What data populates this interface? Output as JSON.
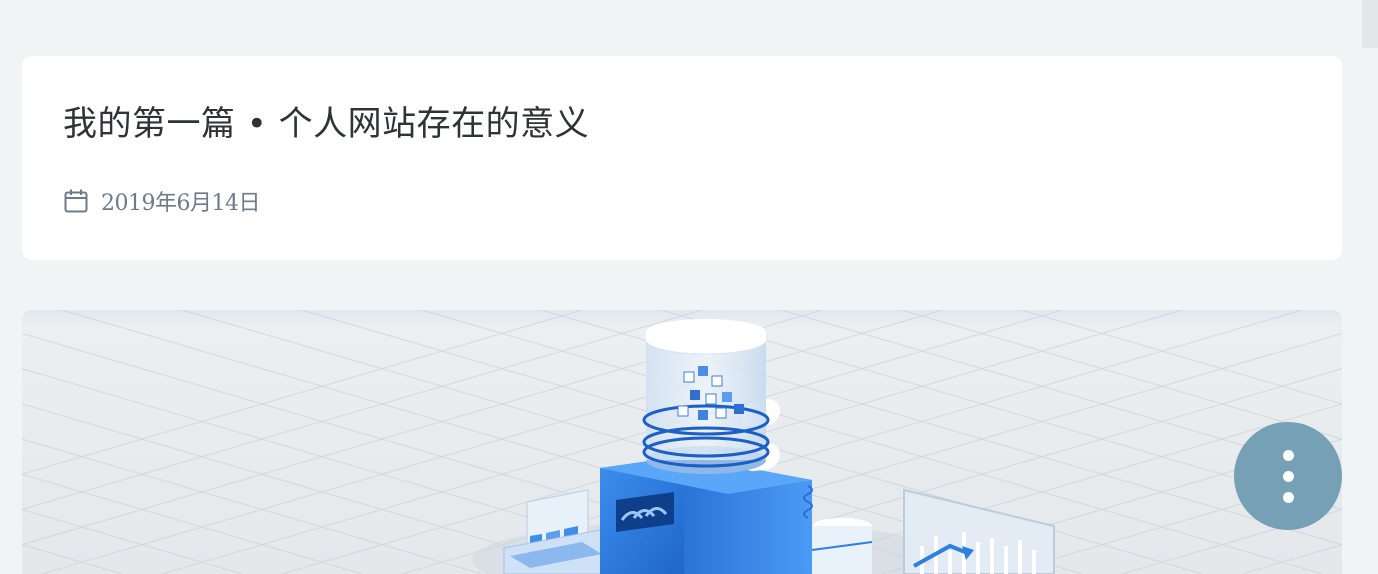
{
  "post": {
    "title": "我的第一篇 • 个人网站存在的意义",
    "date": "2019年6月14日",
    "date_icon": "calendar-icon"
  },
  "cover": {
    "description_icon": "isometric-data-machine-illustration"
  },
  "fab": {
    "icon": "more-vertical-icon",
    "color": "#76a0b6"
  },
  "colors": {
    "page_background": "#f1f4f5",
    "card_background": "#ffffff",
    "title_text": "#2f3337",
    "meta_text": "#6d7a88",
    "illustration_blue": "#2f7fe0"
  }
}
